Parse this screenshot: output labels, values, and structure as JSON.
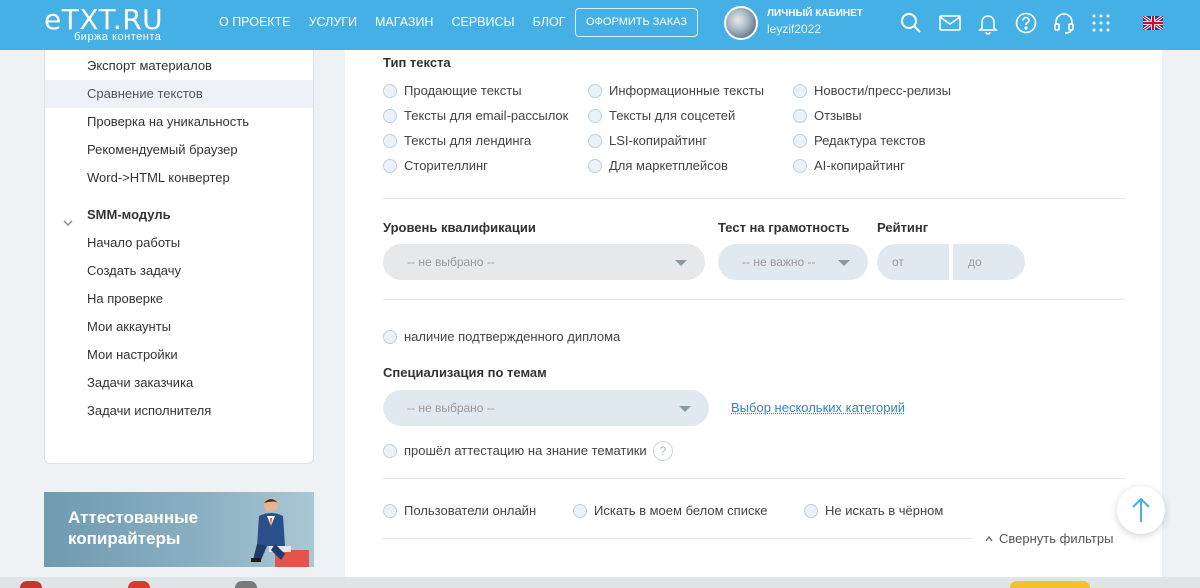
{
  "header": {
    "logo": "eTXT.RU",
    "logo_subtitle": "биржа контента",
    "nav": [
      "О ПРОЕКТЕ",
      "УСЛУГИ",
      "МАГАЗИН",
      "СЕРВИСЫ",
      "БЛОГ"
    ],
    "order_button": "ОФОРМИТЬ ЗАКАЗ",
    "cabinet_title": "ЛИЧНЫЙ КАБИНЕТ",
    "username": "leyzif2022",
    "icons": [
      "search-icon",
      "mail-icon",
      "bell-icon",
      "help-icon",
      "support-icon",
      "apps-grid-icon",
      "uk-flag-icon"
    ],
    "colors": {
      "bar": "#45b0e5"
    }
  },
  "sidebar": {
    "items": [
      "Экспорт материалов",
      "Сравнение текстов",
      "Проверка на уникальность",
      "Рекомендуемый браузер",
      "Word->HTML конвертер"
    ],
    "active_item": "Сравнение текстов",
    "group_title": "SMM-модуль",
    "group_items": [
      "Начало работы",
      "Создать задачу",
      "На проверке",
      "Мои аккаунты",
      "Мои настройки",
      "Задачи заказчика",
      "Задачи исполнителя"
    ],
    "banner_text_line1": "Аттестованные",
    "banner_text_line2": "копирайтеры"
  },
  "filters": {
    "text_type_title": "Тип текста",
    "text_types": [
      "Продающие тексты",
      "Информационные тексты",
      "Новости/пресс-релизы",
      "Тексты для email-рассылок",
      "Тексты для соцсетей",
      "Отзывы",
      "Тексты для лендинга",
      "LSI-копирайтинг",
      "Редактура текстов",
      "Сторителлинг",
      "Для маркетплейсов",
      "AI-копирайтинг"
    ],
    "qualification_label": "Уровень квалификации",
    "qualification_value": "-- не выбрано --",
    "literacy_label": "Тест на грамотность",
    "literacy_value": "-- не важно --",
    "rating_label": "Рейтинг",
    "rating_from": "от",
    "rating_to": "до",
    "diploma_label": "наличие подтвержденного диплома",
    "specialization_label": "Специализация по темам",
    "specialization_value": "-- не выбрано --",
    "multi_category_link": "Выбор нескольких категорий",
    "attestation_label": "прошёл аттестацию на знание тематики",
    "help_mark": "?",
    "online_users": "Пользователи онлайн",
    "whitelist": "Искать в моем белом списке",
    "not_blacklist": "Не искать в чёрном",
    "collapse_filters": "Свернуть фильтры"
  }
}
